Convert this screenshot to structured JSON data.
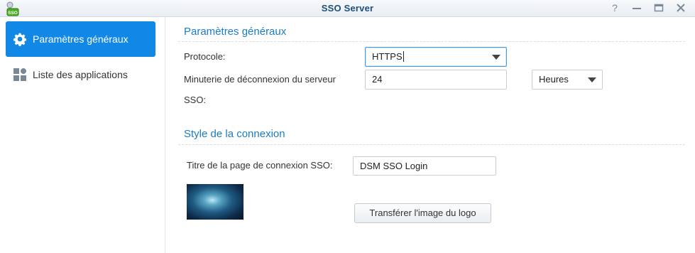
{
  "window": {
    "title": "SSO Server",
    "app_icon_text": "SSO"
  },
  "sidebar": {
    "items": [
      {
        "label": "Paramètres généraux",
        "icon": "gear-icon",
        "active": true
      },
      {
        "label": "Liste des applications",
        "icon": "apps-grid-icon",
        "active": false
      }
    ]
  },
  "general": {
    "section_title": "Paramètres généraux",
    "protocol_label": "Protocole:",
    "protocol_value": "HTTPS",
    "timer_label_line1": "Minuterie de déconnexion du serveur",
    "timer_label_line2": "SSO:",
    "timer_value": "24",
    "timer_unit": "Heures"
  },
  "login_style": {
    "section_title": "Style de la connexion",
    "page_title_label": "Titre de la page de connexion SSO:",
    "page_title_value": "DSM SSO Login",
    "upload_button": "Transférer l'image du logo"
  },
  "colors": {
    "accent": "#1187e6",
    "section_title": "#1a7cc4"
  }
}
